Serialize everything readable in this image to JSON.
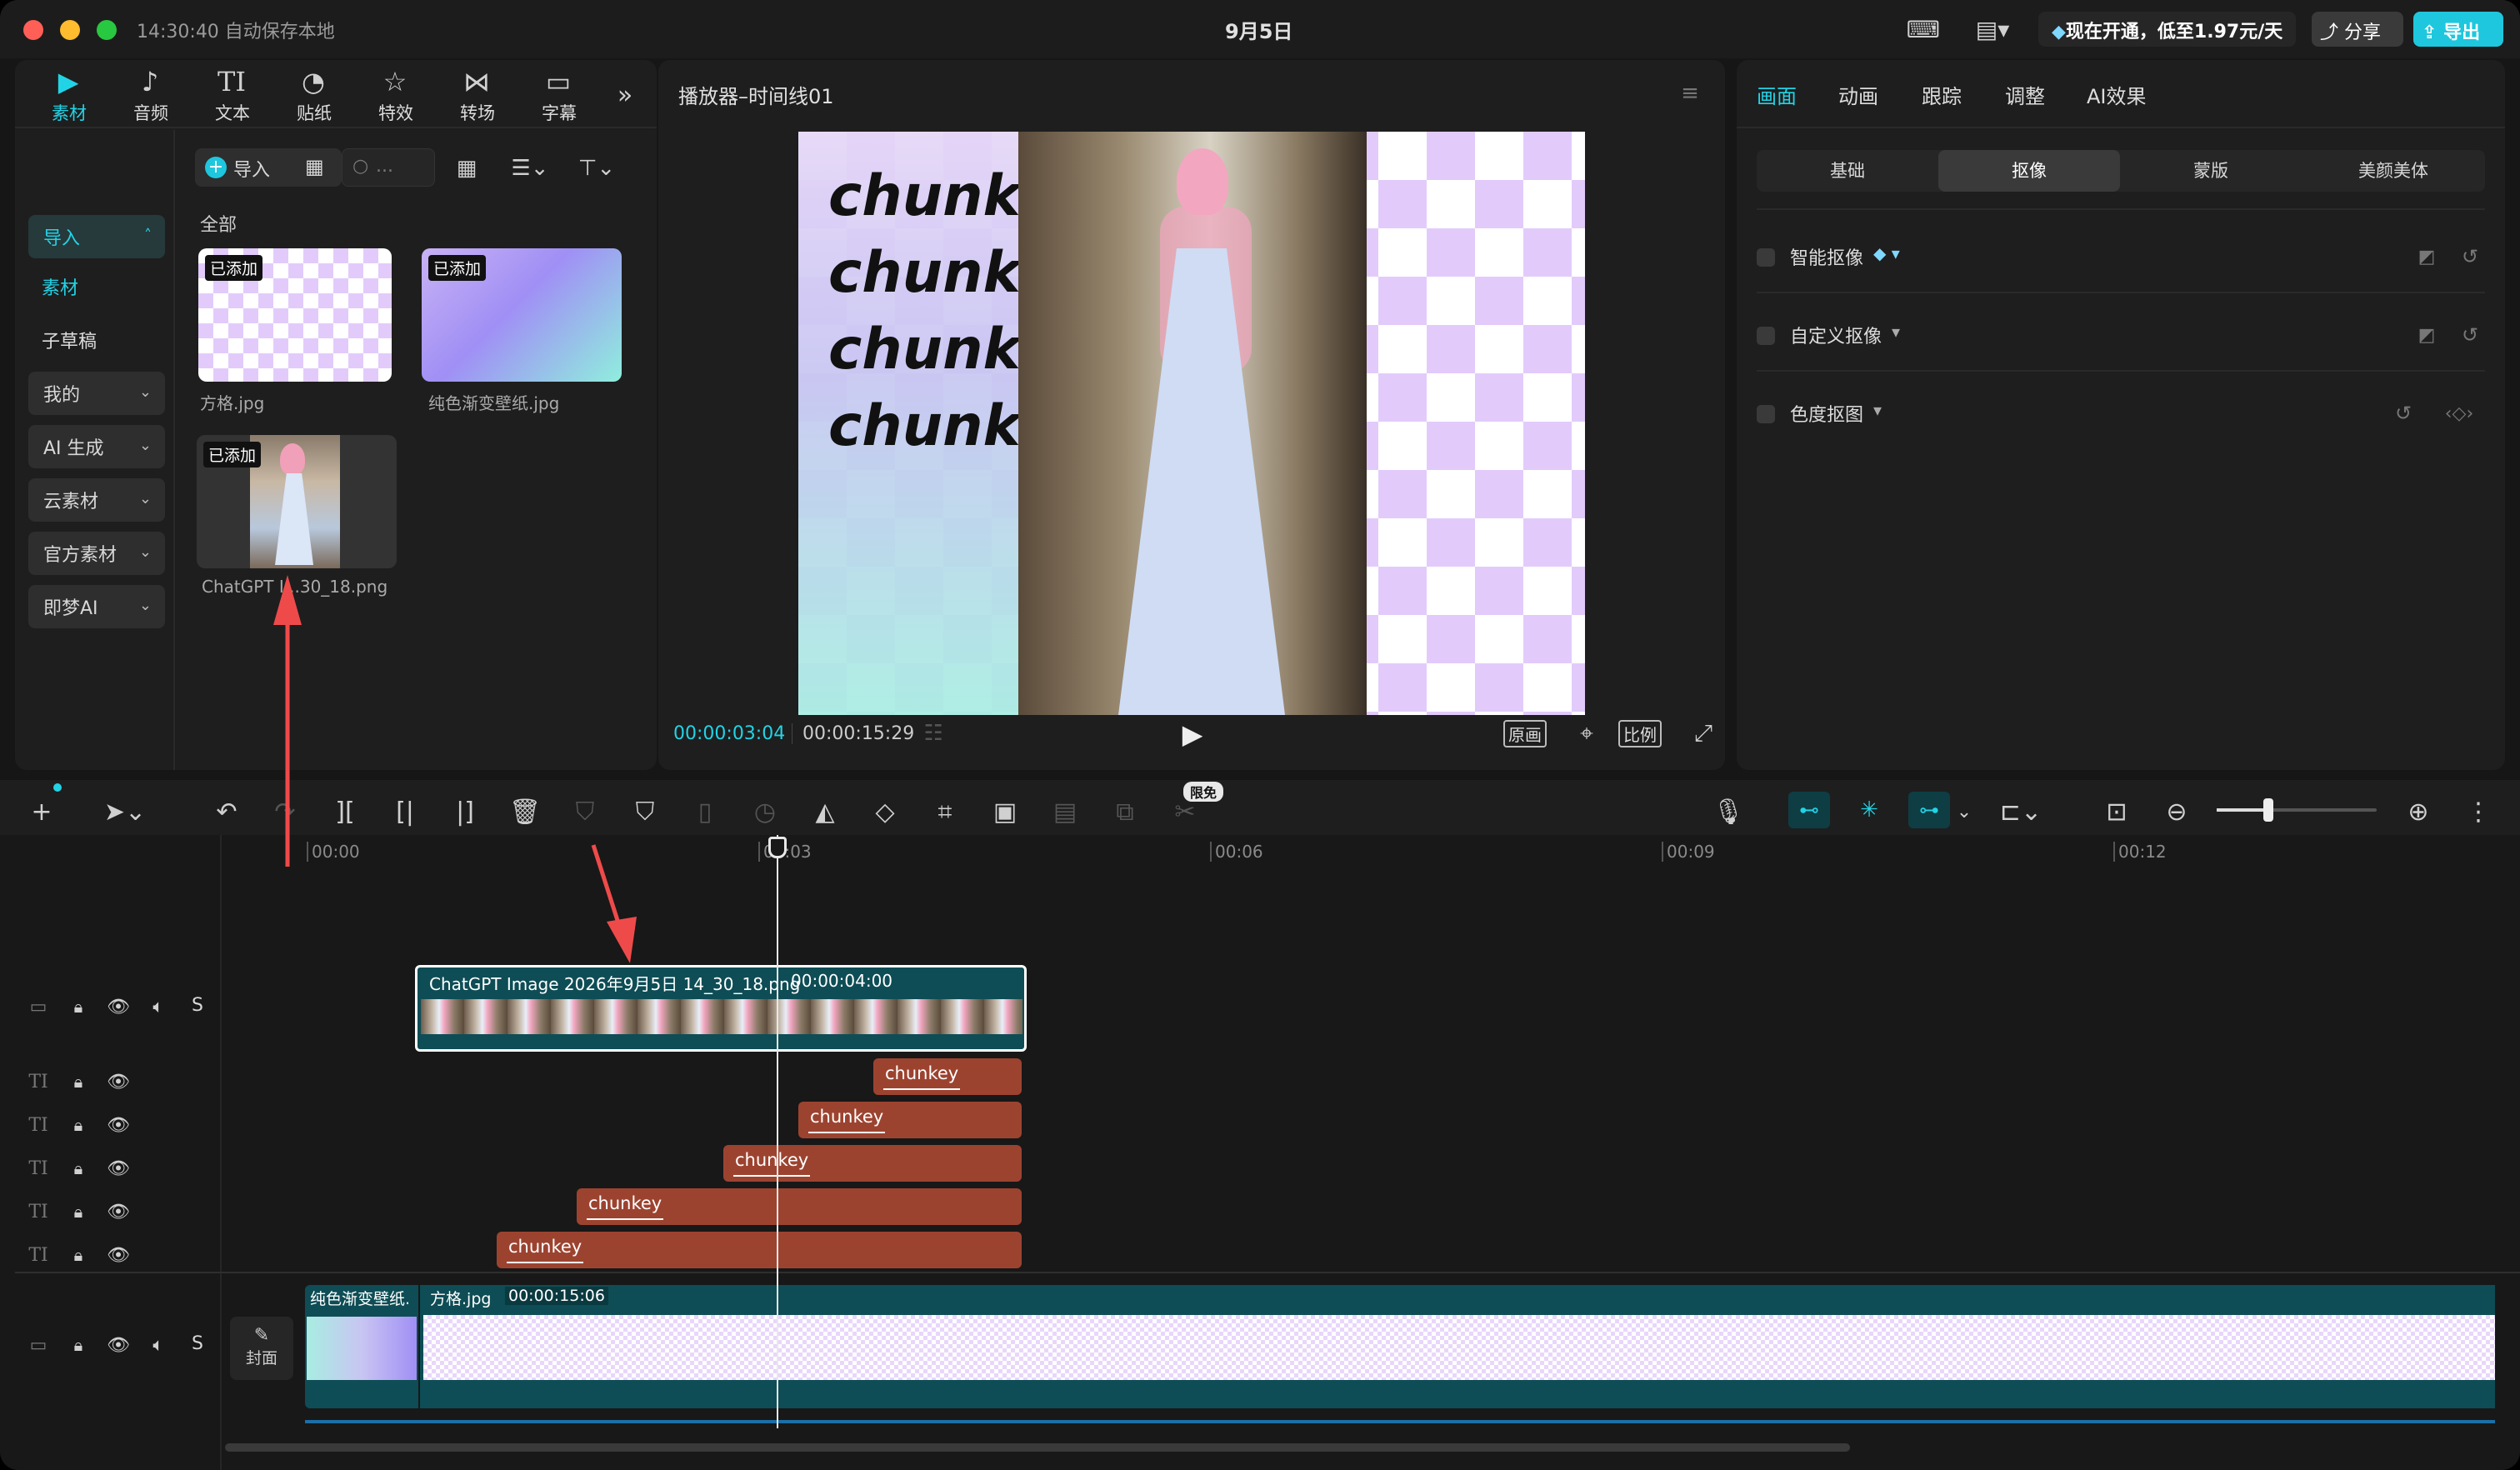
{
  "titlebar": {
    "autosave": "14:30:40 自动保存本地",
    "title": "9月5日",
    "promo": "现在开通，低至1.97元/天",
    "share": "分享",
    "export": "导出"
  },
  "media_tabs": [
    {
      "label": "素材",
      "icon": "media-icon",
      "active": true
    },
    {
      "label": "音频",
      "icon": "audio-icon"
    },
    {
      "label": "文本",
      "icon": "text-icon"
    },
    {
      "label": "贴纸",
      "icon": "sticker-icon"
    },
    {
      "label": "特效",
      "icon": "effects-icon"
    },
    {
      "label": "转场",
      "icon": "transition-icon"
    },
    {
      "label": "字幕",
      "icon": "caption-icon"
    }
  ],
  "sidebar": {
    "import": "导入",
    "items": [
      "素材",
      "子草稿"
    ],
    "dropdowns": [
      "我的",
      "AI 生成",
      "云素材",
      "官方素材",
      "即梦AI"
    ]
  },
  "media": {
    "import_button": "导入",
    "search_placeholder": "...",
    "section": "全部",
    "added_badge": "已添加",
    "items": [
      {
        "name": "方格.jpg"
      },
      {
        "name": "纯色渐变壁纸.jpg"
      },
      {
        "name": "ChatGPT I...30_18.png"
      }
    ]
  },
  "player": {
    "title": "播放器–时间线01",
    "overlay_text": [
      "chunke",
      "chunke",
      "chunke",
      "chunke"
    ],
    "current_time": "00:00:03:04",
    "total_time": "00:00:15:29",
    "btn_original": "原画",
    "btn_ratio": "比例"
  },
  "inspector": {
    "tabs": [
      "画面",
      "动画",
      "跟踪",
      "调整",
      "AI效果"
    ],
    "subtabs": [
      "基础",
      "抠像",
      "蒙版",
      "美颜美体"
    ],
    "options": [
      "智能抠像",
      "自定义抠像",
      "色度抠图"
    ]
  },
  "timeline": {
    "free_badge": "限免",
    "ruler": [
      "00:00",
      "00:03",
      "00:06",
      "00:09",
      "00:12"
    ],
    "video_clip": {
      "label": "ChatGPT Image 2026年9月5日 14_30_18.png",
      "duration": "00:00:04:00"
    },
    "text_clip_label": "chunkey",
    "bg_clip": {
      "label1": "纯色渐变壁纸.",
      "label2": "方格.jpg",
      "duration": "00:00:15:06"
    },
    "cover": "封面",
    "track_solo": "S"
  },
  "colors": {
    "accent": "#22d3e6",
    "text_clip": "#9c4330",
    "video_track": "#0e4d55"
  }
}
